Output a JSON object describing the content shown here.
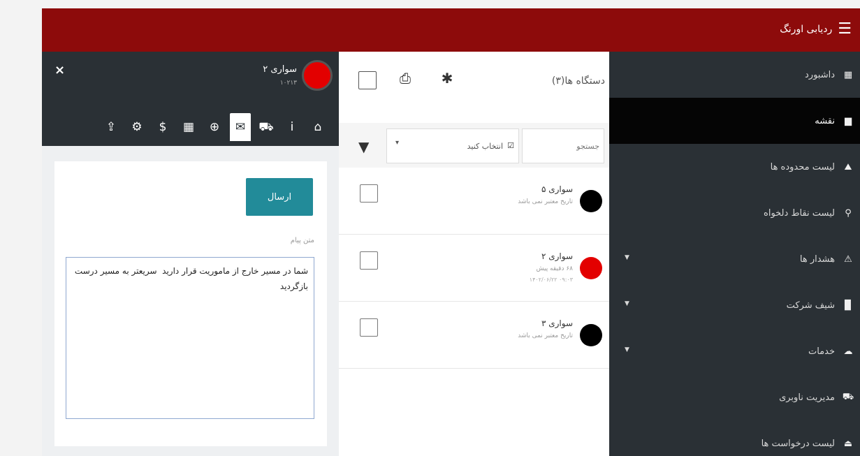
{
  "app": {
    "title": "ردیابی اورنگ",
    "menu_icon": "hamburger-icon"
  },
  "sidebar": {
    "items": [
      {
        "label": "داشبورد",
        "icon": "dashboard-icon",
        "glyph": "▦",
        "active": false,
        "has_submenu": false
      },
      {
        "label": "نقشه",
        "icon": "map-icon",
        "glyph": "▆",
        "active": true,
        "has_submenu": false
      },
      {
        "label": "لیست محدوده ها",
        "icon": "area-icon",
        "glyph": "⛰",
        "active": false,
        "has_submenu": false
      },
      {
        "label": "لیست نقاط دلخواه",
        "icon": "map-marker-icon",
        "glyph": "⚲",
        "active": false,
        "has_submenu": false
      },
      {
        "label": "هشدار ها",
        "icon": "warning-icon",
        "glyph": "⚠",
        "active": false,
        "has_submenu": true
      },
      {
        "label": "شیف شرکت",
        "icon": "building-icon",
        "glyph": "▉",
        "active": false,
        "has_submenu": true
      },
      {
        "label": "خدمات",
        "icon": "cloud-icon",
        "glyph": "☁",
        "active": false,
        "has_submenu": true
      },
      {
        "label": "مدیریت ناوبری",
        "icon": "car-icon",
        "glyph": "⛟",
        "active": false,
        "has_submenu": false
      },
      {
        "label": "لیست درخواست ها",
        "icon": "ticket-icon",
        "glyph": "⏏",
        "active": false,
        "has_submenu": false
      }
    ]
  },
  "devices": {
    "title": "دستگاه ها(۳)",
    "search_placeholder": "جستجو",
    "select_label": "انتخاب کنید",
    "select_caret": "▾",
    "rows": [
      {
        "name": "سواری ۵",
        "subtitle": "تاریخ معتبر نمی باشد",
        "extra": "",
        "status_color": "#000000"
      },
      {
        "name": "سواری ۲",
        "subtitle": "۶۸ دقیقه پیش",
        "extra": "۱۴۰۲/۰۶/۲۲ ۰۹:۰۳",
        "status_color": "#e30000"
      },
      {
        "name": "سواری ۳",
        "subtitle": "تاریخ معتبر نمی باشد",
        "extra": "",
        "status_color": "#000000"
      }
    ]
  },
  "detail": {
    "close_label": "×",
    "vehicle_name": "سواری ۲",
    "vehicle_code": "۱۰۲۱۳",
    "status_color": "#e30000",
    "tabs": [
      {
        "icon": "home-icon",
        "glyph": "⌂"
      },
      {
        "icon": "info-icon",
        "glyph": "i"
      },
      {
        "icon": "car-icon",
        "glyph": "⛟"
      },
      {
        "icon": "envelope-icon",
        "glyph": "✉"
      },
      {
        "icon": "globe-icon",
        "glyph": "⊕"
      },
      {
        "icon": "calendar-icon",
        "glyph": "▦"
      },
      {
        "icon": "dollar-icon",
        "glyph": "$"
      },
      {
        "icon": "gear-icon",
        "glyph": "⚙"
      },
      {
        "icon": "upload-icon",
        "glyph": "⇪"
      }
    ],
    "active_tab": 3,
    "send_label": "ارسال",
    "message_label": "متن پیام",
    "message_text": "شما در مسیر خارج از ماموریت قرار دارید  سریعتر به مسیر درست بازگردید"
  },
  "colors": {
    "topbar": "#8d0b0b",
    "sidebar": "#2a3035",
    "sidebar_active": "#050505",
    "send_button": "#228b99",
    "status_red": "#e30000"
  }
}
